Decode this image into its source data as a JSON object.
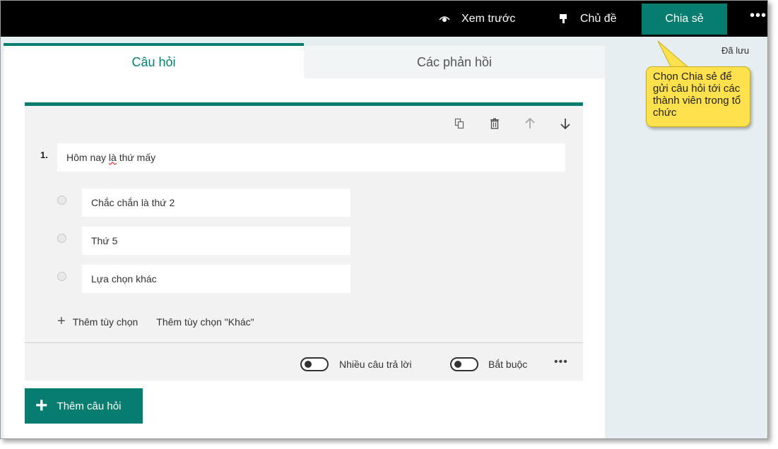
{
  "header": {
    "preview_label": "Xem trước",
    "theme_label": "Chủ đề",
    "share_label": "Chia sẻ",
    "more_label": "•••",
    "saved_status": "Đã lưu",
    "icons": {
      "preview": "eye-icon",
      "theme": "paint-bucket-icon"
    }
  },
  "tabs": [
    {
      "label": "Câu hỏi",
      "active": true
    },
    {
      "label": "Các phản hồi",
      "active": false
    }
  ],
  "question": {
    "number": "1.",
    "title_prefix": "Hôm nay ",
    "title_misspelled": "là",
    "title_suffix": " thứ mấy",
    "tools": [
      "copy-icon",
      "trash-icon",
      "arrow-up-icon",
      "arrow-down-icon"
    ],
    "options": [
      {
        "label": "Chắc chắn là thứ 2"
      },
      {
        "label": "Thứ 5"
      },
      {
        "label": "Lựa chọn khác"
      }
    ],
    "add_option_label": "Thêm tùy chọn",
    "add_other_label": "Thêm tùy chọn \"Khác\"",
    "multiple_answers_label": "Nhiều câu trả lời",
    "multiple_answers_on": false,
    "required_label": "Bắt buộc",
    "required_on": false,
    "more_label": "•••"
  },
  "add_question_label": "Thêm câu hỏi",
  "callout_text": "Chọn Chia sẻ để gửi câu hỏi tới các thành viên trong tổ chức",
  "colors": {
    "accent": "#077d6f",
    "callout": "#ffe14d",
    "topbar": "#000000"
  }
}
